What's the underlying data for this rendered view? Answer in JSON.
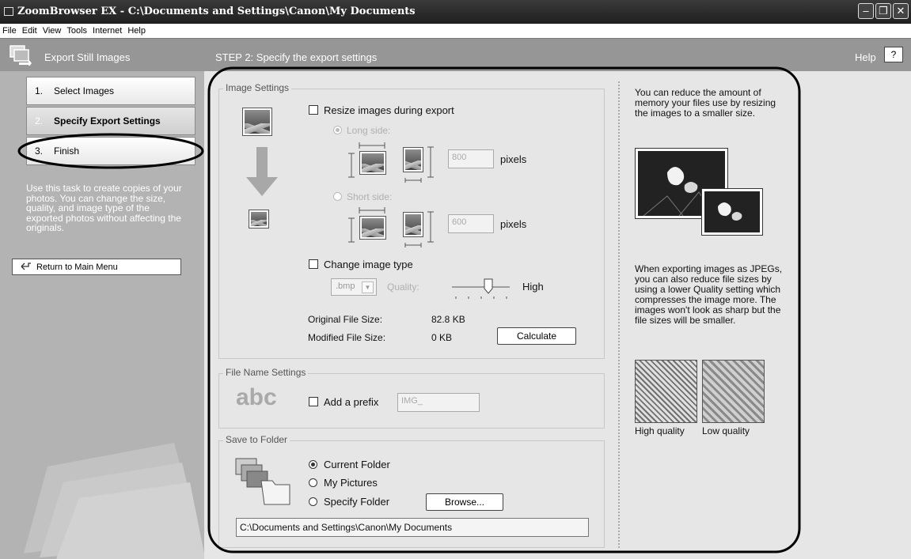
{
  "window": {
    "title": "ZoomBrowser EX  -  C:\\Documents and Settings\\Canon\\My Documents"
  },
  "menu": [
    "File",
    "Edit",
    "View",
    "Tools",
    "Internet",
    "Help"
  ],
  "header": {
    "task_title": "Export Still Images",
    "step_title": "STEP 2: Specify the export settings",
    "help_label": "Help",
    "help_button": "?"
  },
  "steps": [
    {
      "num": "1.",
      "label": "Select Images"
    },
    {
      "num": "2.",
      "label": "Specify Export Settings"
    },
    {
      "num": "3.",
      "label": "Finish"
    }
  ],
  "sidebar": {
    "description": "Use this task to create copies of your photos. You can change the size, quality, and image type of the exported photos without affecting the originals.",
    "return_button": "Return to Main Menu"
  },
  "image_settings": {
    "title": "Image Settings",
    "resize_label": "Resize images during export",
    "long_side_label": "Long side:",
    "long_side_value": "800",
    "short_side_label": "Short side:",
    "short_side_value": "600",
    "pixels_label": "pixels",
    "change_type_label": "Change image type",
    "type_value": ".bmp",
    "quality_label": "Quality:",
    "quality_value_label": "High",
    "original_size_label": "Original File Size:",
    "original_size_value": "82.8 KB",
    "modified_size_label": "Modified File Size:",
    "modified_size_value": "0 KB",
    "calculate_button": "Calculate"
  },
  "file_name_settings": {
    "title": "File Name Settings",
    "abc": "abc",
    "prefix_label": "Add a prefix",
    "prefix_value": "IMG_"
  },
  "save_to_folder": {
    "title": "Save to Folder",
    "options": [
      "Current Folder",
      "My Pictures",
      "Specify Folder"
    ],
    "selected": "Current Folder",
    "browse_button": "Browse...",
    "path": "C:\\Documents and Settings\\Canon\\My Documents"
  },
  "help_panel": {
    "text1": "You can reduce the amount of memory your files use by resizing the images to a smaller size.",
    "text2": "When exporting images as JPEGs, you can also reduce file sizes by using a lower Quality setting which compresses the image more. The images won't look as sharp but the file sizes will be smaller.",
    "high_quality_label": "High quality",
    "low_quality_label": "Low quality"
  }
}
